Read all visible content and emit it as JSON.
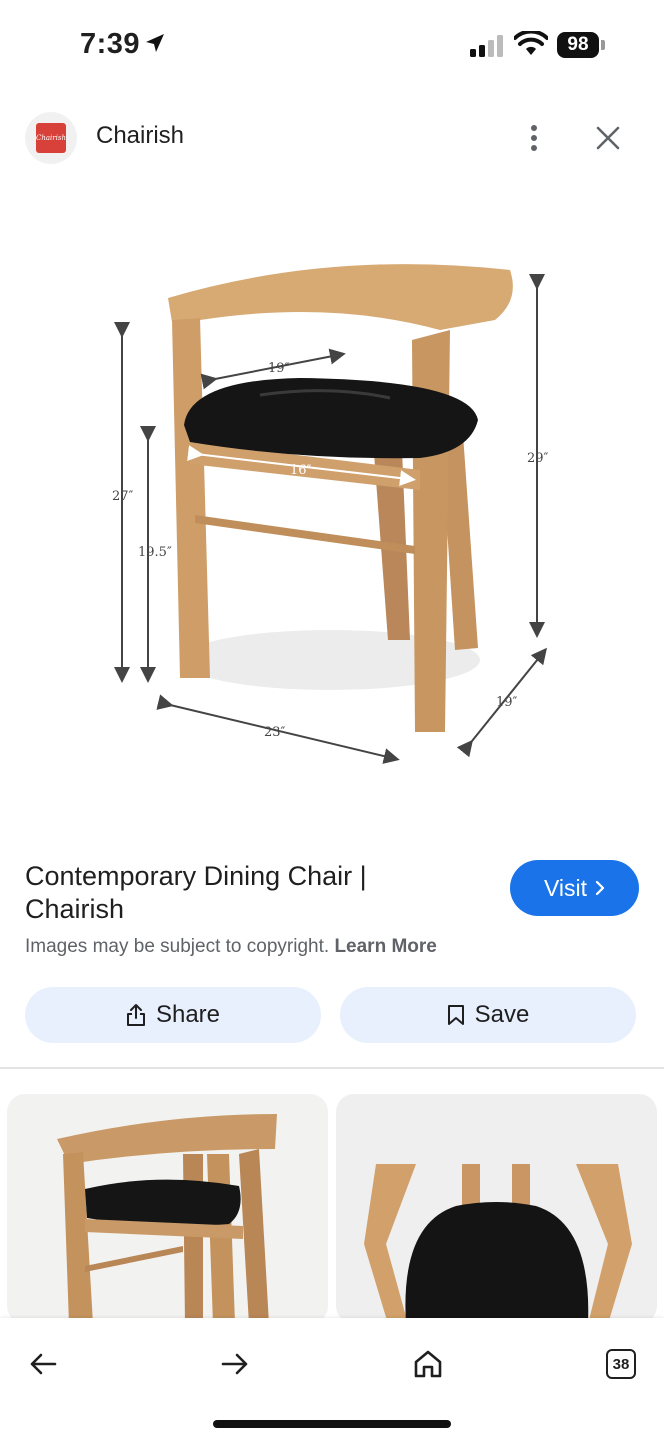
{
  "status_bar": {
    "time": "7:39",
    "battery": "98"
  },
  "header": {
    "site_logo_text": "Chairish",
    "site_name": "Chairish"
  },
  "image": {
    "dimensions": {
      "back_width": "19″",
      "seat_width": "16″",
      "total_height_left": "27″",
      "seat_height": "19.5″",
      "total_height_right": "29″",
      "depth": "19″",
      "width": "23″"
    }
  },
  "result": {
    "title": "Contemporary Dining Chair | Chairish",
    "visit_label": "Visit",
    "copyright_text": "Images may be subject to copyright.",
    "learn_more": "Learn More",
    "share_label": "Share",
    "save_label": "Save"
  },
  "bottom_nav": {
    "tabs_count": "38"
  },
  "colors": {
    "accent": "#1a73e8",
    "pill_bg": "#e8f0fe",
    "logo_red": "#d8413a"
  }
}
